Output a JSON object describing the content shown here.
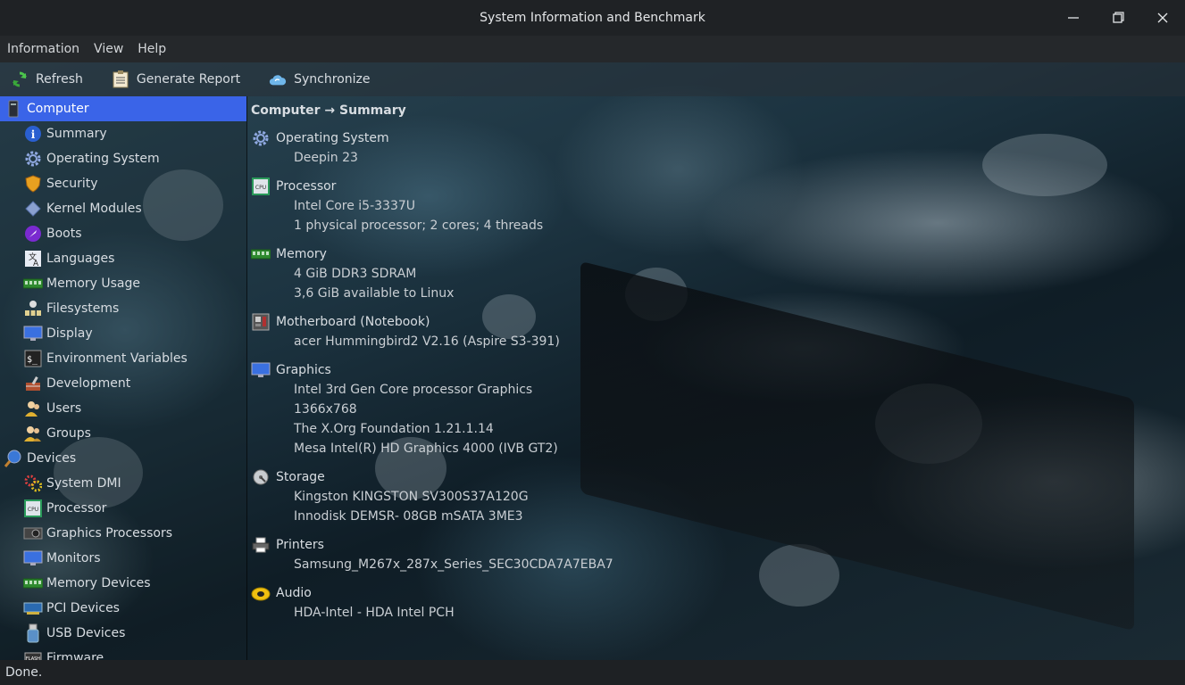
{
  "window": {
    "title": "System Information and Benchmark"
  },
  "menu": [
    "Information",
    "View",
    "Help"
  ],
  "toolbar": {
    "refresh": "Refresh",
    "generate_report": "Generate Report",
    "synchronize": "Synchronize"
  },
  "sidebar": {
    "computer": "Computer",
    "computer_items": [
      "Summary",
      "Operating System",
      "Security",
      "Kernel Modules",
      "Boots",
      "Languages",
      "Memory Usage",
      "Filesystems",
      "Display",
      "Environment Variables",
      "Development",
      "Users",
      "Groups"
    ],
    "devices": "Devices",
    "device_items": [
      "System DMI",
      "Processor",
      "Graphics Processors",
      "Monitors",
      "Memory Devices",
      "PCI Devices",
      "USB Devices",
      "Firmware"
    ]
  },
  "content": {
    "breadcrumb": "Computer → Summary",
    "sections": [
      {
        "title": "Operating System",
        "icon": "gear-icon",
        "lines": [
          "Deepin 23"
        ]
      },
      {
        "title": "Processor",
        "icon": "cpu-icon",
        "lines": [
          "Intel Core i5-3337U",
          "1 physical processor; 2 cores; 4 threads"
        ]
      },
      {
        "title": "Memory",
        "icon": "memory-icon",
        "lines": [
          "4 GiB DDR3 SDRAM",
          "3,6 GiB available to Linux"
        ]
      },
      {
        "title": "Motherboard (Notebook)",
        "icon": "motherboard-icon",
        "lines": [
          "acer Hummingbird2 V2.16 (Aspire S3-391)"
        ]
      },
      {
        "title": "Graphics",
        "icon": "monitor-icon",
        "lines": [
          "Intel 3rd Gen Core processor Graphics",
          "1366x768",
          "The X.Org Foundation 1.21.1.14",
          "Mesa Intel(R) HD Graphics 4000 (IVB GT2)"
        ]
      },
      {
        "title": "Storage",
        "icon": "disk-icon",
        "lines": [
          "Kingston KINGSTON SV300S37A120G",
          "Innodisk DEMSR- 08GB mSATA 3ME3"
        ]
      },
      {
        "title": "Printers",
        "icon": "printer-icon",
        "lines": [
          "Samsung_M267x_287x_Series_SEC30CDA7A7EBA7"
        ]
      },
      {
        "title": "Audio",
        "icon": "audio-icon",
        "lines": [
          "HDA-Intel - HDA Intel PCH"
        ]
      }
    ]
  },
  "status": "Done."
}
